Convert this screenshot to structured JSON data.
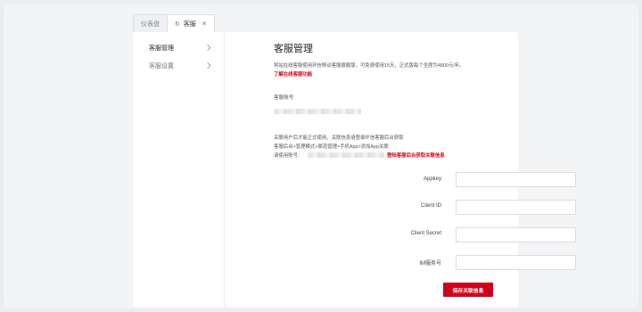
{
  "tabs": [
    {
      "label": "仪表盘",
      "active": false
    },
    {
      "label": "客服",
      "active": true,
      "icon": "refresh-icon",
      "close": "×"
    }
  ],
  "sidebar": {
    "items": [
      {
        "label": "客服管理",
        "active": true
      },
      {
        "label": "客服设置",
        "active": false
      }
    ]
  },
  "main": {
    "title": "客服管理",
    "description": "将站在线客服使用环信移动客服旗舰版，可免费使用15天，正式版每个坐席为4800元/年。",
    "learn_more": "了解在线客服功能",
    "account_label": "客服账号",
    "notes": {
      "line1": "关联用户后才能正式使用，关联信息请登录环信客服后台获取",
      "line2": "客服后台>管理模式>渠道管理>手机App>添加App关联",
      "line3_prefix": "请使用账号：",
      "login_link": "登陆客服后台获取关联信息"
    },
    "form": {
      "fields": [
        {
          "label": "Appkey",
          "value": "",
          "placeholder": ""
        },
        {
          "label": "Client ID",
          "value": "",
          "placeholder": ""
        },
        {
          "label": "Client Secret",
          "value": "",
          "placeholder": ""
        },
        {
          "label": "IM服务号",
          "value": "",
          "placeholder": ""
        }
      ],
      "save_label": "保存关联信息"
    }
  },
  "colors": {
    "accent": "#d0021b",
    "frame": "#f3f4f6",
    "panel": "#ffffff"
  }
}
